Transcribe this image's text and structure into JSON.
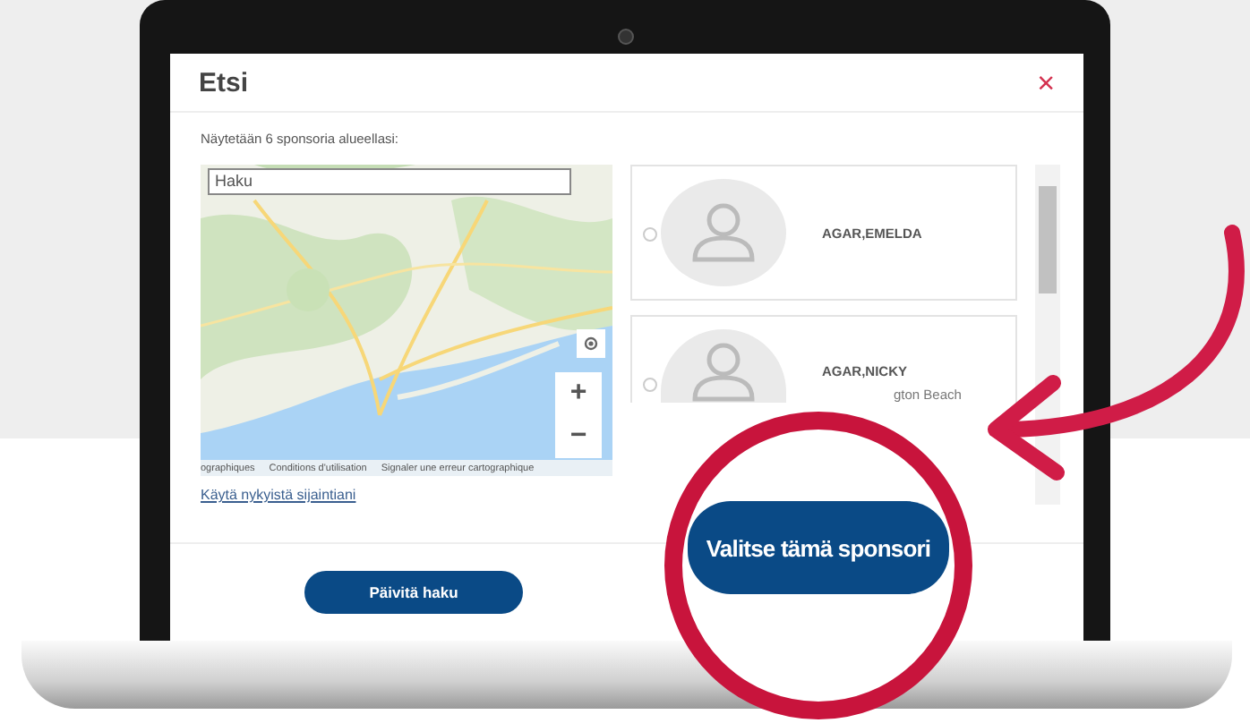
{
  "dialog": {
    "title": "Etsi",
    "close": "×"
  },
  "summary": "Näytetään 6 sponsoria alueellasi:",
  "map": {
    "search": {
      "placeholder": "Haku"
    },
    "zoom_in": "+",
    "zoom_out": "−",
    "attribution": [
      "ographiques",
      "Conditions d'utilisation",
      "Signaler une erreur cartographique"
    ],
    "location_link": "Käytä nykyistä sijaintiani"
  },
  "sponsors": [
    {
      "name": "AGAR,EMELDA",
      "selected": false
    },
    {
      "name": "AGAR,NICKY",
      "location": "gton Beach",
      "selected": false
    }
  ],
  "refresh_button": "Päivitä haku",
  "callout": {
    "button": "Valitse tämä sponsori"
  }
}
